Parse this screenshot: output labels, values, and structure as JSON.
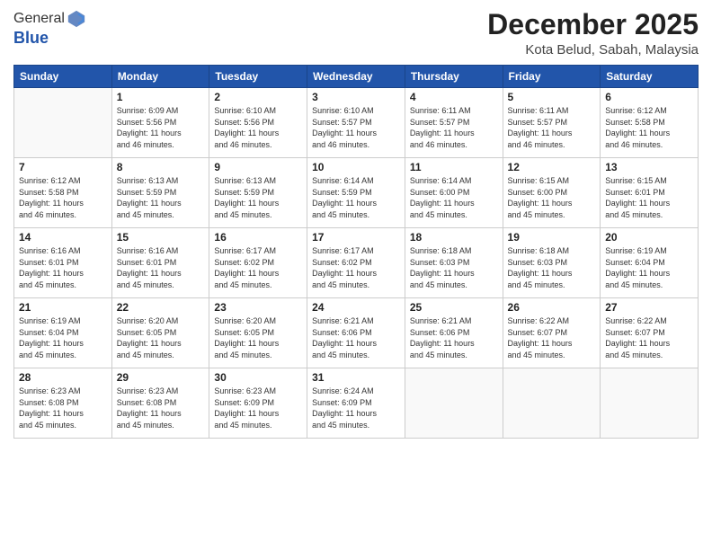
{
  "header": {
    "logo_line1": "General",
    "logo_line2": "Blue",
    "month_title": "December 2025",
    "location": "Kota Belud, Sabah, Malaysia"
  },
  "weekdays": [
    "Sunday",
    "Monday",
    "Tuesday",
    "Wednesday",
    "Thursday",
    "Friday",
    "Saturday"
  ],
  "weeks": [
    [
      {
        "day": "",
        "info": ""
      },
      {
        "day": "1",
        "info": "Sunrise: 6:09 AM\nSunset: 5:56 PM\nDaylight: 11 hours\nand 46 minutes."
      },
      {
        "day": "2",
        "info": "Sunrise: 6:10 AM\nSunset: 5:56 PM\nDaylight: 11 hours\nand 46 minutes."
      },
      {
        "day": "3",
        "info": "Sunrise: 6:10 AM\nSunset: 5:57 PM\nDaylight: 11 hours\nand 46 minutes."
      },
      {
        "day": "4",
        "info": "Sunrise: 6:11 AM\nSunset: 5:57 PM\nDaylight: 11 hours\nand 46 minutes."
      },
      {
        "day": "5",
        "info": "Sunrise: 6:11 AM\nSunset: 5:57 PM\nDaylight: 11 hours\nand 46 minutes."
      },
      {
        "day": "6",
        "info": "Sunrise: 6:12 AM\nSunset: 5:58 PM\nDaylight: 11 hours\nand 46 minutes."
      }
    ],
    [
      {
        "day": "7",
        "info": "Sunrise: 6:12 AM\nSunset: 5:58 PM\nDaylight: 11 hours\nand 46 minutes."
      },
      {
        "day": "8",
        "info": "Sunrise: 6:13 AM\nSunset: 5:59 PM\nDaylight: 11 hours\nand 45 minutes."
      },
      {
        "day": "9",
        "info": "Sunrise: 6:13 AM\nSunset: 5:59 PM\nDaylight: 11 hours\nand 45 minutes."
      },
      {
        "day": "10",
        "info": "Sunrise: 6:14 AM\nSunset: 5:59 PM\nDaylight: 11 hours\nand 45 minutes."
      },
      {
        "day": "11",
        "info": "Sunrise: 6:14 AM\nSunset: 6:00 PM\nDaylight: 11 hours\nand 45 minutes."
      },
      {
        "day": "12",
        "info": "Sunrise: 6:15 AM\nSunset: 6:00 PM\nDaylight: 11 hours\nand 45 minutes."
      },
      {
        "day": "13",
        "info": "Sunrise: 6:15 AM\nSunset: 6:01 PM\nDaylight: 11 hours\nand 45 minutes."
      }
    ],
    [
      {
        "day": "14",
        "info": "Sunrise: 6:16 AM\nSunset: 6:01 PM\nDaylight: 11 hours\nand 45 minutes."
      },
      {
        "day": "15",
        "info": "Sunrise: 6:16 AM\nSunset: 6:01 PM\nDaylight: 11 hours\nand 45 minutes."
      },
      {
        "day": "16",
        "info": "Sunrise: 6:17 AM\nSunset: 6:02 PM\nDaylight: 11 hours\nand 45 minutes."
      },
      {
        "day": "17",
        "info": "Sunrise: 6:17 AM\nSunset: 6:02 PM\nDaylight: 11 hours\nand 45 minutes."
      },
      {
        "day": "18",
        "info": "Sunrise: 6:18 AM\nSunset: 6:03 PM\nDaylight: 11 hours\nand 45 minutes."
      },
      {
        "day": "19",
        "info": "Sunrise: 6:18 AM\nSunset: 6:03 PM\nDaylight: 11 hours\nand 45 minutes."
      },
      {
        "day": "20",
        "info": "Sunrise: 6:19 AM\nSunset: 6:04 PM\nDaylight: 11 hours\nand 45 minutes."
      }
    ],
    [
      {
        "day": "21",
        "info": "Sunrise: 6:19 AM\nSunset: 6:04 PM\nDaylight: 11 hours\nand 45 minutes."
      },
      {
        "day": "22",
        "info": "Sunrise: 6:20 AM\nSunset: 6:05 PM\nDaylight: 11 hours\nand 45 minutes."
      },
      {
        "day": "23",
        "info": "Sunrise: 6:20 AM\nSunset: 6:05 PM\nDaylight: 11 hours\nand 45 minutes."
      },
      {
        "day": "24",
        "info": "Sunrise: 6:21 AM\nSunset: 6:06 PM\nDaylight: 11 hours\nand 45 minutes."
      },
      {
        "day": "25",
        "info": "Sunrise: 6:21 AM\nSunset: 6:06 PM\nDaylight: 11 hours\nand 45 minutes."
      },
      {
        "day": "26",
        "info": "Sunrise: 6:22 AM\nSunset: 6:07 PM\nDaylight: 11 hours\nand 45 minutes."
      },
      {
        "day": "27",
        "info": "Sunrise: 6:22 AM\nSunset: 6:07 PM\nDaylight: 11 hours\nand 45 minutes."
      }
    ],
    [
      {
        "day": "28",
        "info": "Sunrise: 6:23 AM\nSunset: 6:08 PM\nDaylight: 11 hours\nand 45 minutes."
      },
      {
        "day": "29",
        "info": "Sunrise: 6:23 AM\nSunset: 6:08 PM\nDaylight: 11 hours\nand 45 minutes."
      },
      {
        "day": "30",
        "info": "Sunrise: 6:23 AM\nSunset: 6:09 PM\nDaylight: 11 hours\nand 45 minutes."
      },
      {
        "day": "31",
        "info": "Sunrise: 6:24 AM\nSunset: 6:09 PM\nDaylight: 11 hours\nand 45 minutes."
      },
      {
        "day": "",
        "info": ""
      },
      {
        "day": "",
        "info": ""
      },
      {
        "day": "",
        "info": ""
      }
    ]
  ]
}
